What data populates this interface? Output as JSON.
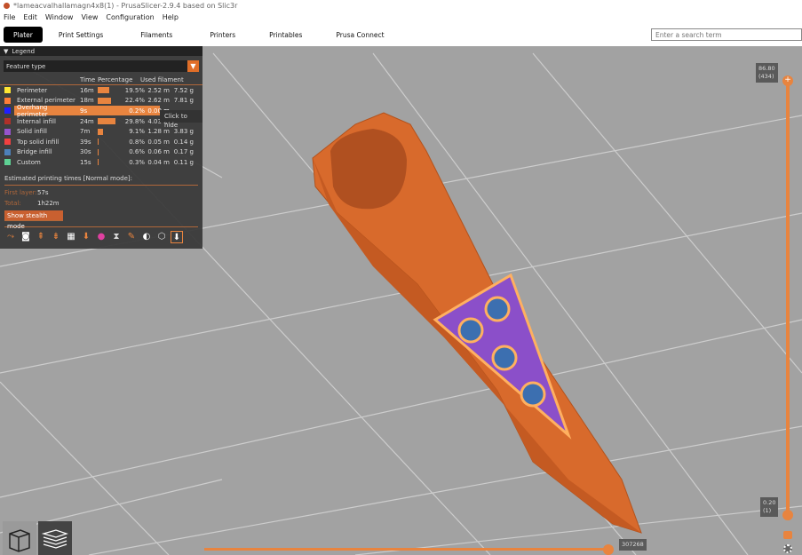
{
  "title": "*lameacvalhallamagn4x8(1) - PrusaSlicer-2.9.4 based on Slic3r",
  "menu": [
    "File",
    "Edit",
    "Window",
    "View",
    "Configuration",
    "Help"
  ],
  "tabs": [
    "Plater",
    "Print Settings",
    "Filaments",
    "Printers",
    "Printables",
    "Prusa Connect"
  ],
  "search": {
    "placeholder": "Enter a search term"
  },
  "legend": {
    "title": "Legend",
    "view_type": "Feature type",
    "headers": {
      "time": "Time",
      "percentage": "Percentage",
      "used": "Used filament"
    },
    "rows": [
      {
        "name": "Perimeter",
        "color": "#ffe633",
        "time": "16m",
        "pct": "19.5%",
        "pct_value": 19.5,
        "len": "2.52 m",
        "weight": "7.52 g"
      },
      {
        "name": "External perimeter",
        "color": "#ff7d38",
        "time": "18m",
        "pct": "22.4%",
        "pct_value": 22.4,
        "len": "2.62 m",
        "weight": "7.81 g"
      },
      {
        "name": "Overhang perimeter",
        "color": "#1f1fff",
        "time": "9s",
        "pct": "0.2%",
        "pct_value": 0.2,
        "len": "0.00 m",
        "weight": "",
        "highlighted": true
      },
      {
        "name": "Internal infill",
        "color": "#b03029",
        "time": "24m",
        "pct": "29.8%",
        "pct_value": 29.8,
        "len": "4.03 m",
        "weight": ""
      },
      {
        "name": "Solid infill",
        "color": "#9654cc",
        "time": "7m",
        "pct": "9.1%",
        "pct_value": 9.1,
        "len": "1.28 m",
        "weight": "3.83 g"
      },
      {
        "name": "Top solid infill",
        "color": "#f04040",
        "time": "39s",
        "pct": "0.8%",
        "pct_value": 0.8,
        "len": "0.05 m",
        "weight": "0.14 g"
      },
      {
        "name": "Bridge infill",
        "color": "#4d80ba",
        "time": "30s",
        "pct": "0.6%",
        "pct_value": 0.6,
        "len": "0.06 m",
        "weight": "0.17 g"
      },
      {
        "name": "Custom",
        "color": "#5ed194",
        "time": "15s",
        "pct": "0.3%",
        "pct_value": 0.3,
        "len": "0.04 m",
        "weight": "0.11 g"
      }
    ],
    "tooltip": "Click to hide",
    "estimated": "Estimated printing times [Normal mode]:",
    "first_layer_label": "First layer:",
    "first_layer": "57s",
    "total_label": "Total:",
    "total": "1h22m",
    "stealth_button": "Show stealth mode"
  },
  "slider": {
    "top_value": "86.80",
    "top_layer": "(434)",
    "bottom_value": "0.20",
    "bottom_layer": "(1)",
    "horizontal_value": "307268"
  },
  "accent": "#e8843f"
}
